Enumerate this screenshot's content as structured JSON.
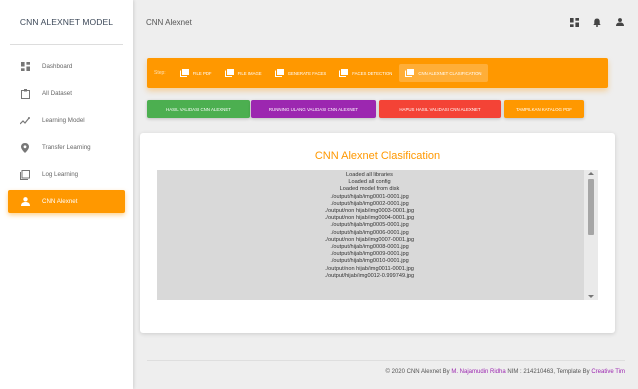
{
  "brand": "CNN ALEXNET MODEL",
  "sidebar": {
    "items": [
      {
        "label": "Dashboard",
        "icon": "dashboard-icon"
      },
      {
        "label": "All Dataset",
        "icon": "clipboard-icon"
      },
      {
        "label": "Learning Model",
        "icon": "chart-icon"
      },
      {
        "label": "Transfer Learning",
        "icon": "location-pin-icon"
      },
      {
        "label": "Log Learning",
        "icon": "library-icon"
      },
      {
        "label": "CNN Alexnet",
        "icon": "person-icon",
        "active": true
      }
    ]
  },
  "header": {
    "title": "CNN Alexnet",
    "icons": [
      "dashboard-icon",
      "notifications-icon",
      "person-icon"
    ]
  },
  "tabs": {
    "label": "Step:",
    "items": [
      {
        "label": "File PDF"
      },
      {
        "label": "File Image"
      },
      {
        "label": "Generate Faces"
      },
      {
        "label": "Faces Detection"
      },
      {
        "label": "CNN Alexnet Clasification",
        "active": true
      }
    ]
  },
  "actions": [
    {
      "label": "Hasil Validasi CNN Alexnet",
      "color": "#4caf50"
    },
    {
      "label": "Running Ulang Validasi CNN Alexnet",
      "color": "#9c27b0"
    },
    {
      "label": "Hapus Hasil Validasi CNN Alexnet",
      "color": "#f44336"
    },
    {
      "label": "Tampilkan Katalog PDF",
      "color": "#ff9800"
    }
  ],
  "card": {
    "title": "CNN Alexnet Clasification",
    "log": [
      "Loaded all libraries",
      "Loaded all config",
      "Loaded model from disk",
      "./output/hijab/img0001-0001.jpg",
      "./output/hijab/img0002-0001.jpg",
      "./output/non hijab/img0003-0001.jpg",
      "./output/non hijab/img0004-0001.jpg",
      "./output/hijab/img0005-0001.jpg",
      "./output/hijab/img0006-0001.jpg",
      "./output/non hijab/img0007-0001.jpg",
      "./output/hijab/img0008-0001.jpg",
      "./output/hijab/img0009-0001.jpg",
      "./output/hijab/img0010-0001.jpg",
      "./output/non hijab/img0011-0001.jpg",
      "./output/hijab/img0012-0.999749.jpg"
    ]
  },
  "footer": {
    "prefix": "© 2020 CNN Alexnet By",
    "author": "M. Najamudin Ridha",
    "middle": "NIM : 214210463, Template By",
    "template_author": "Creative Tim"
  },
  "colors": {
    "accent": "#ff9800",
    "title_accent": "#ff9800",
    "link": "#9c27b0"
  }
}
